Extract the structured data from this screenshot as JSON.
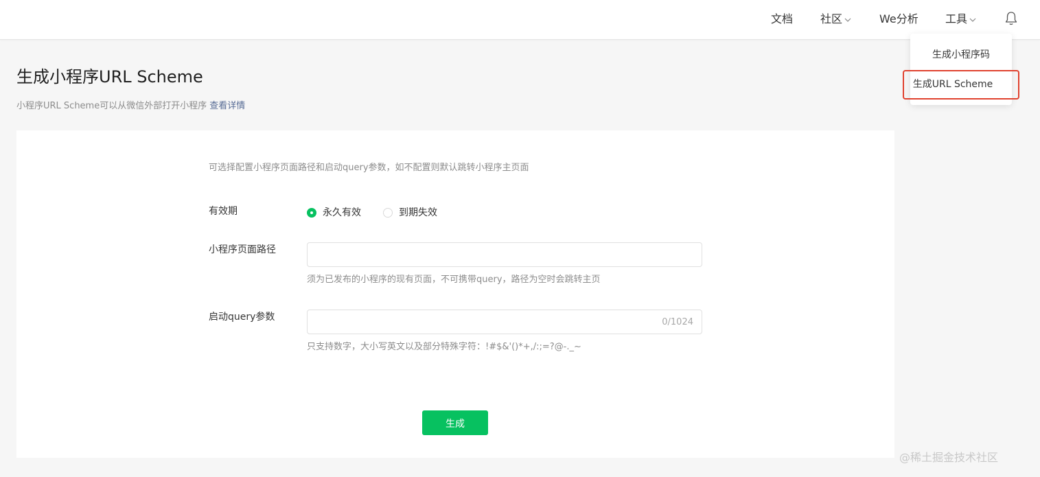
{
  "nav": {
    "docs": "文档",
    "community": "社区",
    "analytics": "We分析",
    "tools": "工具"
  },
  "dropdown": {
    "items": [
      "生成小程序码",
      "生成URL Scheme"
    ]
  },
  "page": {
    "title": "生成小程序URL Scheme",
    "subtitle": "小程序URL Scheme可以从微信外部打开小程序",
    "details_link": "查看详情"
  },
  "form": {
    "hint": "可选择配置小程序页面路径和启动query参数，如不配置则默认跳转小程序主页面",
    "validity": {
      "label": "有效期",
      "options": [
        "永久有效",
        "到期失效"
      ],
      "selected": "永久有效"
    },
    "path": {
      "label": "小程序页面路径",
      "value": "",
      "help": "须为已发布的小程序的现有页面，不可携带query，路径为空时会跳转主页"
    },
    "query": {
      "label": "启动query参数",
      "value": "",
      "counter": "0/1024",
      "help": "只支持数字，大小写英文以及部分特殊字符：!#$&'()*+,/:;=?@-._~"
    },
    "submit_label": "生成"
  },
  "watermark": "@稀土掘金技术社区",
  "colors": {
    "accent": "#07c160",
    "link": "#576b95",
    "highlight_border": "#e0412e"
  }
}
